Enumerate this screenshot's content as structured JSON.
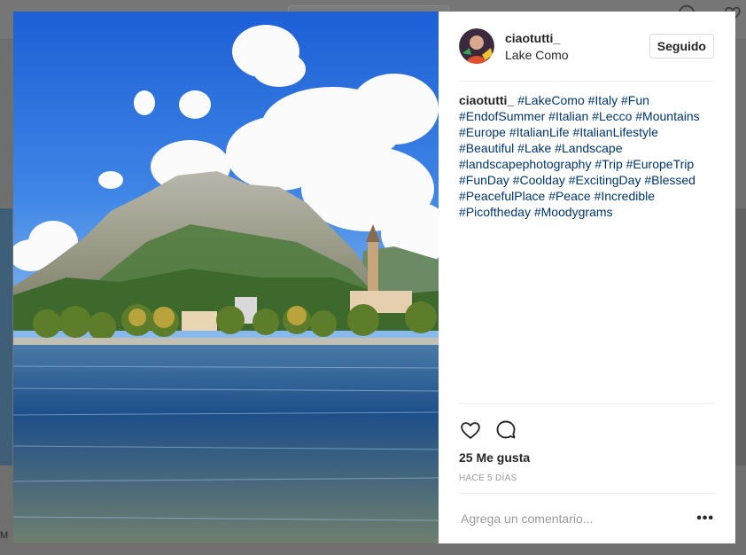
{
  "post": {
    "username": "ciaotutti_",
    "location": "Lake Como",
    "follow_label": "Seguido",
    "caption_author": "ciaotutti_",
    "hashtags": [
      "#LakeComo",
      "#Italy",
      "#Fun",
      "#EndofSummer",
      "#Italian",
      "#Lecco",
      "#Mountains",
      "#Europe",
      "#ItalianLife",
      "#ItalianLifestyle",
      "#Beautiful",
      "#Lake",
      "#Landscape",
      "#landscapephotography",
      "#Trip",
      "#EuropeTrip",
      "#FunDay",
      "#Coolday",
      "#ExcitingDay",
      "#Blessed",
      "#PeacefulPlace",
      "#Peace",
      "#Incredible",
      "#Picoftheday",
      "#Moodygrams"
    ],
    "likes": "25 Me gusta",
    "time": "HACE 5 DÍAS",
    "comment_placeholder": "Agrega un comentario...",
    "more_label": "•••"
  },
  "icons": {
    "like": "heart-icon",
    "comment": "comment-icon",
    "more": "ellipsis-icon"
  },
  "background": {
    "left_letter": "M"
  },
  "colors": {
    "hashtag": "#003569",
    "text": "#262626",
    "muted": "#999999",
    "border": "#efefef",
    "overlay": "#6f6f6f"
  }
}
